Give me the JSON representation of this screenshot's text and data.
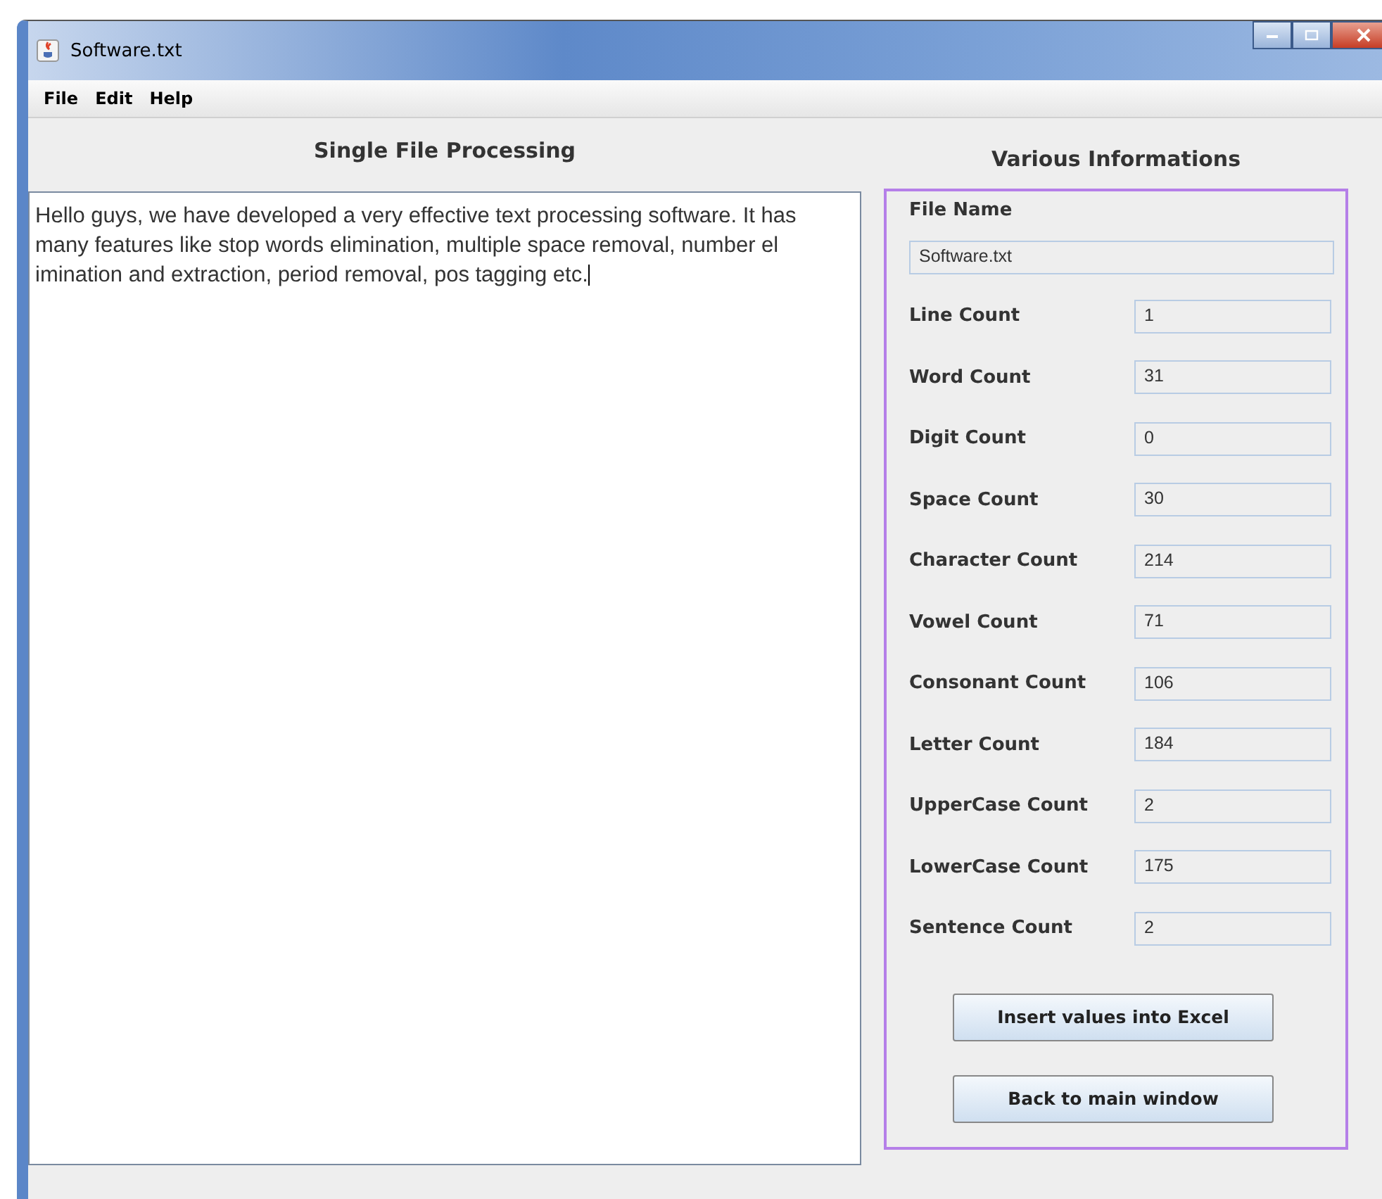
{
  "window": {
    "title": "Software.txt"
  },
  "menu": [
    "File",
    "Edit",
    "Help"
  ],
  "left_panel": {
    "heading": "Single File Processing",
    "text_lines": [
      "Hello guys, we have developed a very effective text processing software. It has",
      "many features like stop words elimination, multiple space removal, number el",
      "imination and extraction, period removal, pos tagging etc."
    ]
  },
  "right_panel": {
    "heading": "Various Informations",
    "file_name": {
      "label": "File Name",
      "value": "Software.txt"
    },
    "stats": [
      {
        "label": "Line Count",
        "value": "1"
      },
      {
        "label": "Word Count",
        "value": "31"
      },
      {
        "label": "Digit Count",
        "value": "0"
      },
      {
        "label": "Space Count",
        "value": "30"
      },
      {
        "label": "Character Count",
        "value": "214"
      },
      {
        "label": "Vowel Count",
        "value": "71"
      },
      {
        "label": "Consonant Count",
        "value": "106"
      },
      {
        "label": "Letter Count",
        "value": "184"
      },
      {
        "label": "UpperCase Count",
        "value": "2"
      },
      {
        "label": "LowerCase Count",
        "value": "175"
      },
      {
        "label": "Sentence Count",
        "value": "2"
      }
    ],
    "buttons": [
      "Insert values into Excel",
      "Back to main window"
    ]
  }
}
